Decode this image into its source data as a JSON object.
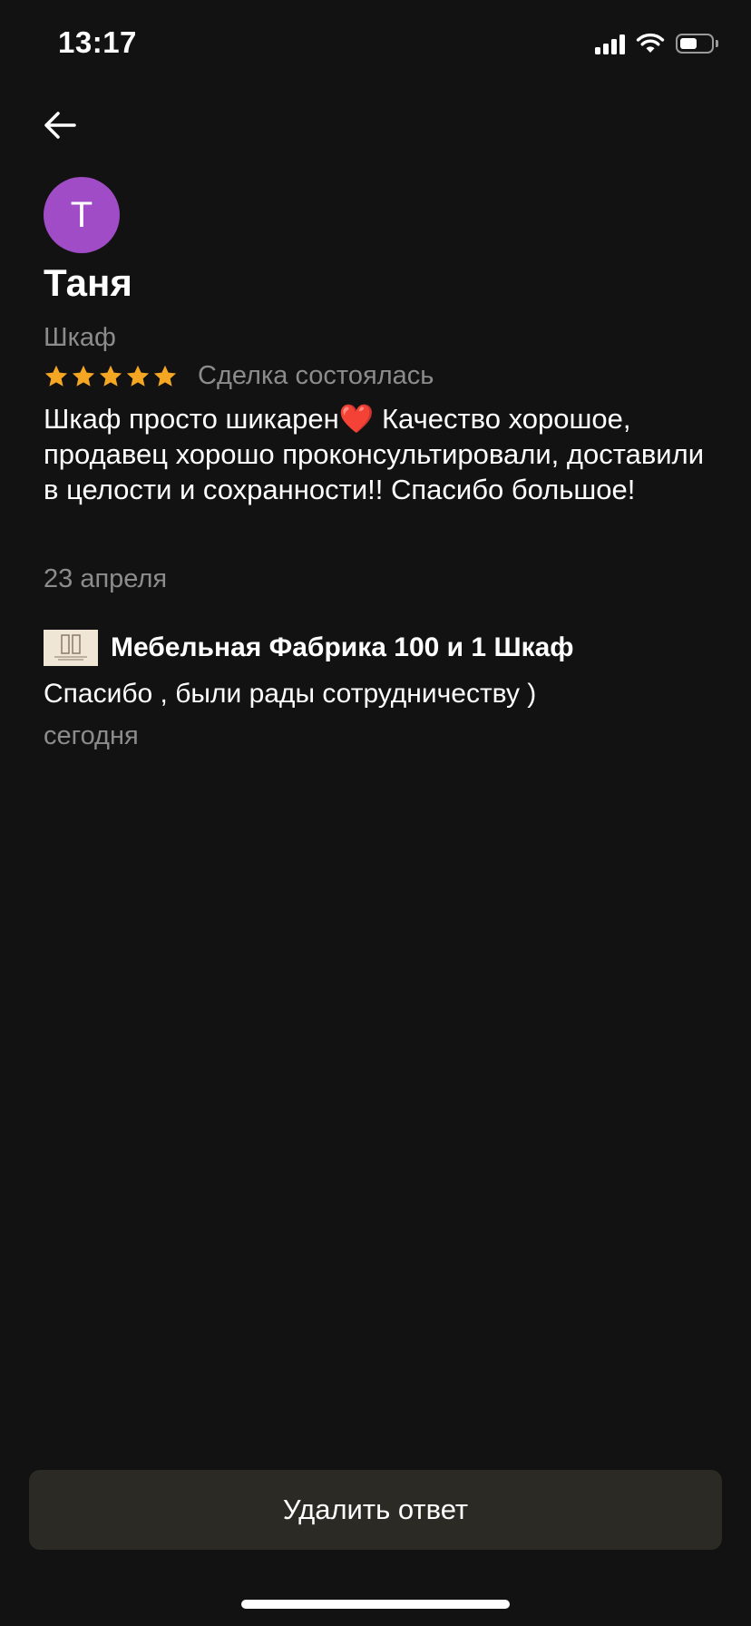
{
  "status_bar": {
    "time": "13:17",
    "icons": [
      "cellular-signal-icon",
      "wifi-icon",
      "battery-icon"
    ],
    "battery_level": 0.62
  },
  "nav": {
    "back_icon": "arrow-left-icon"
  },
  "review": {
    "avatar_letter": "Т",
    "avatar_color": "#9f4cc6",
    "reviewer_name": "Таня",
    "item_name": "Шкаф",
    "rating": 5,
    "rating_max": 5,
    "star_color": "#f5a623",
    "deal_status": "Сделка состоялась",
    "text": "Шкаф просто шикарен❤️ Качество хорошое, продавец хорошо проконсультировали, доставили в целости и сохранности!! Спасибо большое!",
    "date": "23 апреля"
  },
  "reply": {
    "seller_name": "Мебельная Фабрика 100 и 1 Шкаф",
    "text": "Спасибо , были рады сотрудничеству )",
    "date": "сегодня"
  },
  "actions": {
    "delete_label": "Удалить ответ"
  },
  "colors": {
    "background": "#121212",
    "secondary_text": "#8c8c8c",
    "button_bg": "#2c2a24"
  }
}
